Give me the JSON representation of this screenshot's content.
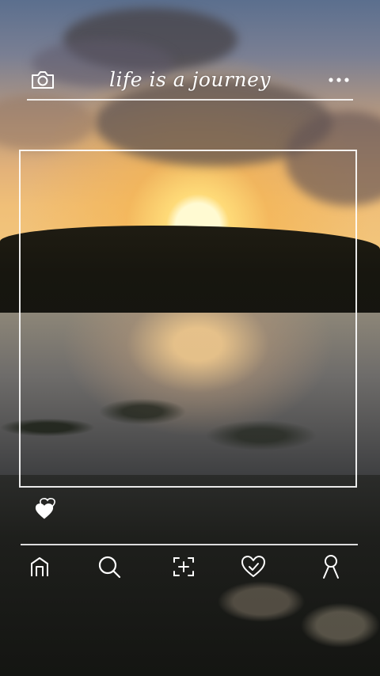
{
  "header": {
    "title": "life is a journey",
    "camera_icon": "camera-icon",
    "more_icon": "more-horizontal-icon"
  },
  "post": {
    "like_icon": "hearts-icon"
  },
  "bottom_nav": {
    "items": [
      {
        "icon": "home-icon"
      },
      {
        "icon": "search-icon"
      },
      {
        "icon": "add-post-icon"
      },
      {
        "icon": "heart-icon"
      },
      {
        "icon": "profile-icon"
      }
    ]
  },
  "colors": {
    "overlay": "#ffffff"
  }
}
